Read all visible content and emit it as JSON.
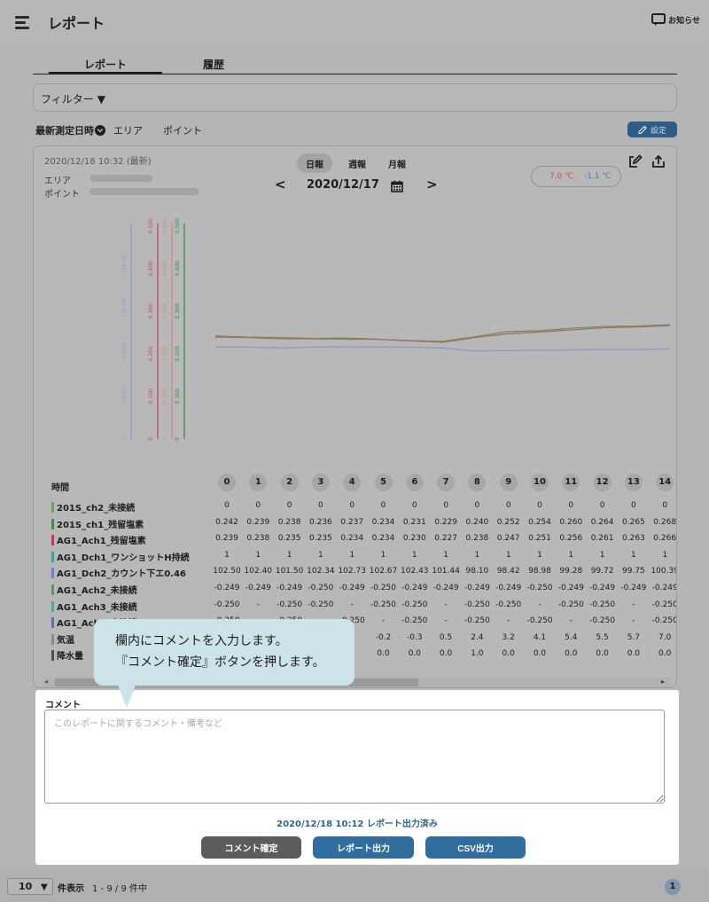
{
  "header": {
    "title": "レポート",
    "notice_label": "お知らせ"
  },
  "tabs": [
    {
      "label": "レポート",
      "active": true
    },
    {
      "label": "履歴",
      "active": false
    }
  ],
  "filter": {
    "label": "フィルター",
    "caret": "▼"
  },
  "sort": {
    "latest": "最新測定日時",
    "area": "エリア",
    "point": "ポイント",
    "settings_label": "設定"
  },
  "report": {
    "datetime": "2020/12/18 10:32 (最新)",
    "area_label": "エリア",
    "point_label": "ポイント",
    "periods": [
      "日報",
      "週報",
      "月報"
    ],
    "selected_period": "日報",
    "date": "2020/12/17",
    "prev_arrow": "<",
    "next_arrow": ">",
    "temp_max": "7.0 ℃",
    "temp_min": "-1.1 ℃"
  },
  "chart_data": {
    "type": "line",
    "x": [
      0,
      1,
      2,
      3,
      4,
      5,
      6,
      7,
      8,
      9,
      10,
      11,
      12,
      13,
      14
    ],
    "axes": [
      {
        "ticks": [
          "0",
          "50.00",
          "100.00",
          "150.00",
          "200.00"
        ],
        "color": "#8ea0c8"
      },
      {
        "ticks": [
          "0",
          "0.100",
          "0.200",
          "0.300",
          "0.400",
          "0.500"
        ],
        "color": "#bf4a5c"
      },
      {
        "ticks": [
          "0",
          "0.100",
          "0.200",
          "0.300",
          "0.400",
          "0.500"
        ],
        "color": "#cc8e8e"
      },
      {
        "ticks": [
          "0",
          "0.100",
          "0.200",
          "0.300",
          "0.400",
          "0.500"
        ],
        "color": "#3f8f3f"
      }
    ],
    "series": [
      {
        "values": [
          0.242,
          0.239,
          0.238,
          0.236,
          0.237,
          0.234,
          0.231,
          0.229,
          0.24,
          0.252,
          0.254,
          0.26,
          0.264,
          0.265,
          0.268
        ],
        "color": "#6f8f55"
      },
      {
        "values": [
          0.239,
          0.238,
          0.235,
          0.235,
          0.234,
          0.234,
          0.23,
          0.227,
          0.238,
          0.247,
          0.251,
          0.256,
          0.261,
          0.263,
          0.266
        ],
        "color": "#a56c6c"
      },
      {
        "values": [
          102.5,
          102.4,
          101.5,
          102.34,
          102.73,
          102.67,
          102.43,
          101.44,
          98.1,
          98.42,
          98.98,
          99.28,
          99.72,
          99.75,
          100.39
        ],
        "color": "#8e98c9"
      }
    ]
  },
  "table": {
    "hour_label": "時間",
    "hours": [
      "0",
      "1",
      "2",
      "3",
      "4",
      "5",
      "6",
      "7",
      "8",
      "9",
      "10",
      "11",
      "12",
      "13",
      "14"
    ],
    "rows": [
      {
        "name": "201S_ch2_未接続",
        "color": "#6aa84f",
        "values": [
          "0",
          "0",
          "0",
          "0",
          "0",
          "0",
          "0",
          "0",
          "0",
          "0",
          "0",
          "0",
          "0",
          "0",
          "0"
        ]
      },
      {
        "name": "201S_ch1_残留塩素",
        "color": "#3c8f3c",
        "values": [
          "0.242",
          "0.239",
          "0.238",
          "0.236",
          "0.237",
          "0.234",
          "0.231",
          "0.229",
          "0.240",
          "0.252",
          "0.254",
          "0.260",
          "0.264",
          "0.265",
          "0.268"
        ]
      },
      {
        "name": "AG1_Ach1_残留塩素",
        "color": "#c0395a",
        "values": [
          "0.239",
          "0.238",
          "0.235",
          "0.235",
          "0.234",
          "0.234",
          "0.230",
          "0.227",
          "0.238",
          "0.247",
          "0.251",
          "0.256",
          "0.261",
          "0.263",
          "0.266"
        ]
      },
      {
        "name": "AG1_Dch1_ワンショットH持続",
        "color": "#3aa39b",
        "values": [
          "1",
          "1",
          "1",
          "1",
          "1",
          "1",
          "1",
          "1",
          "1",
          "1",
          "1",
          "1",
          "1",
          "1",
          "1"
        ]
      },
      {
        "name": "AG1_Dch2_カウント下エ0.46",
        "color": "#7a7ad0",
        "values": [
          "102.50",
          "102.40",
          "101.50",
          "102.34",
          "102.73",
          "102.67",
          "102.43",
          "101.44",
          "98.10",
          "98.42",
          "98.98",
          "99.28",
          "99.72",
          "99.75",
          "100.39"
        ]
      },
      {
        "name": "AG1_Ach2_未接続",
        "color": "#5a9a5a",
        "values": [
          "-0.249",
          "-0.249",
          "-0.249",
          "-0.250",
          "-0.249",
          "-0.250",
          "-0.249",
          "-0.249",
          "-0.249",
          "-0.249",
          "-0.250",
          "-0.249",
          "-0.249",
          "-0.249",
          "-0.249"
        ]
      },
      {
        "name": "AG1_Ach3_未接続",
        "color": "#4fa8a0",
        "values": [
          "-0.250",
          "-",
          "-0.250",
          "-0.250",
          "-",
          "-0.250",
          "-0.250",
          "-",
          "-0.250",
          "-0.250",
          "-",
          "-0.250",
          "-0.250",
          "-",
          "-0.250"
        ]
      },
      {
        "name": "AG1_Ach4_未接続",
        "color": "#6a6aa8",
        "values": [
          "-0.250",
          "-",
          "-0.250",
          "-",
          "-0.250",
          "-",
          "-0.250",
          "-",
          "-0.250",
          "-",
          "-0.250",
          "-",
          "-0.250",
          "-",
          "-0.250"
        ]
      },
      {
        "name": "気温",
        "color": "#8a8a8a",
        "values": [
          "",
          "",
          "",
          "",
          "",
          "-0.2",
          "-0.3",
          "0.5",
          "2.4",
          "3.2",
          "4.1",
          "5.4",
          "5.5",
          "5.7",
          "7.0"
        ]
      },
      {
        "name": "降水量",
        "color": "#505050",
        "values": [
          "",
          "",
          "",
          "",
          "",
          "0.0",
          "0.0",
          "0.0",
          "1.0",
          "0.0",
          "0.0",
          "0.0",
          "0.0",
          "0.0",
          "0.0"
        ]
      }
    ]
  },
  "tooltip": {
    "line1": "欄内にコメントを入力します。",
    "line2": "『コメント確定』ボタンを押します。"
  },
  "comment": {
    "label": "コメント",
    "placeholder": "このレポートに関するコメント・備考など",
    "value": "",
    "status": "2020/12/18 10:12 レポート出力済み",
    "confirm_label": "コメント確定",
    "report_label": "レポート出力",
    "csv_label": "CSV出力"
  },
  "footer": {
    "per_page": "10",
    "per_page_label": "件表示",
    "range": "1 - 9 / 9 件中",
    "page": "1"
  },
  "colors": {
    "primary": "#2f6e9f",
    "confirm": "#5c5c5c",
    "tooltip": "#cde3ea",
    "status_text": "#2f6491"
  }
}
